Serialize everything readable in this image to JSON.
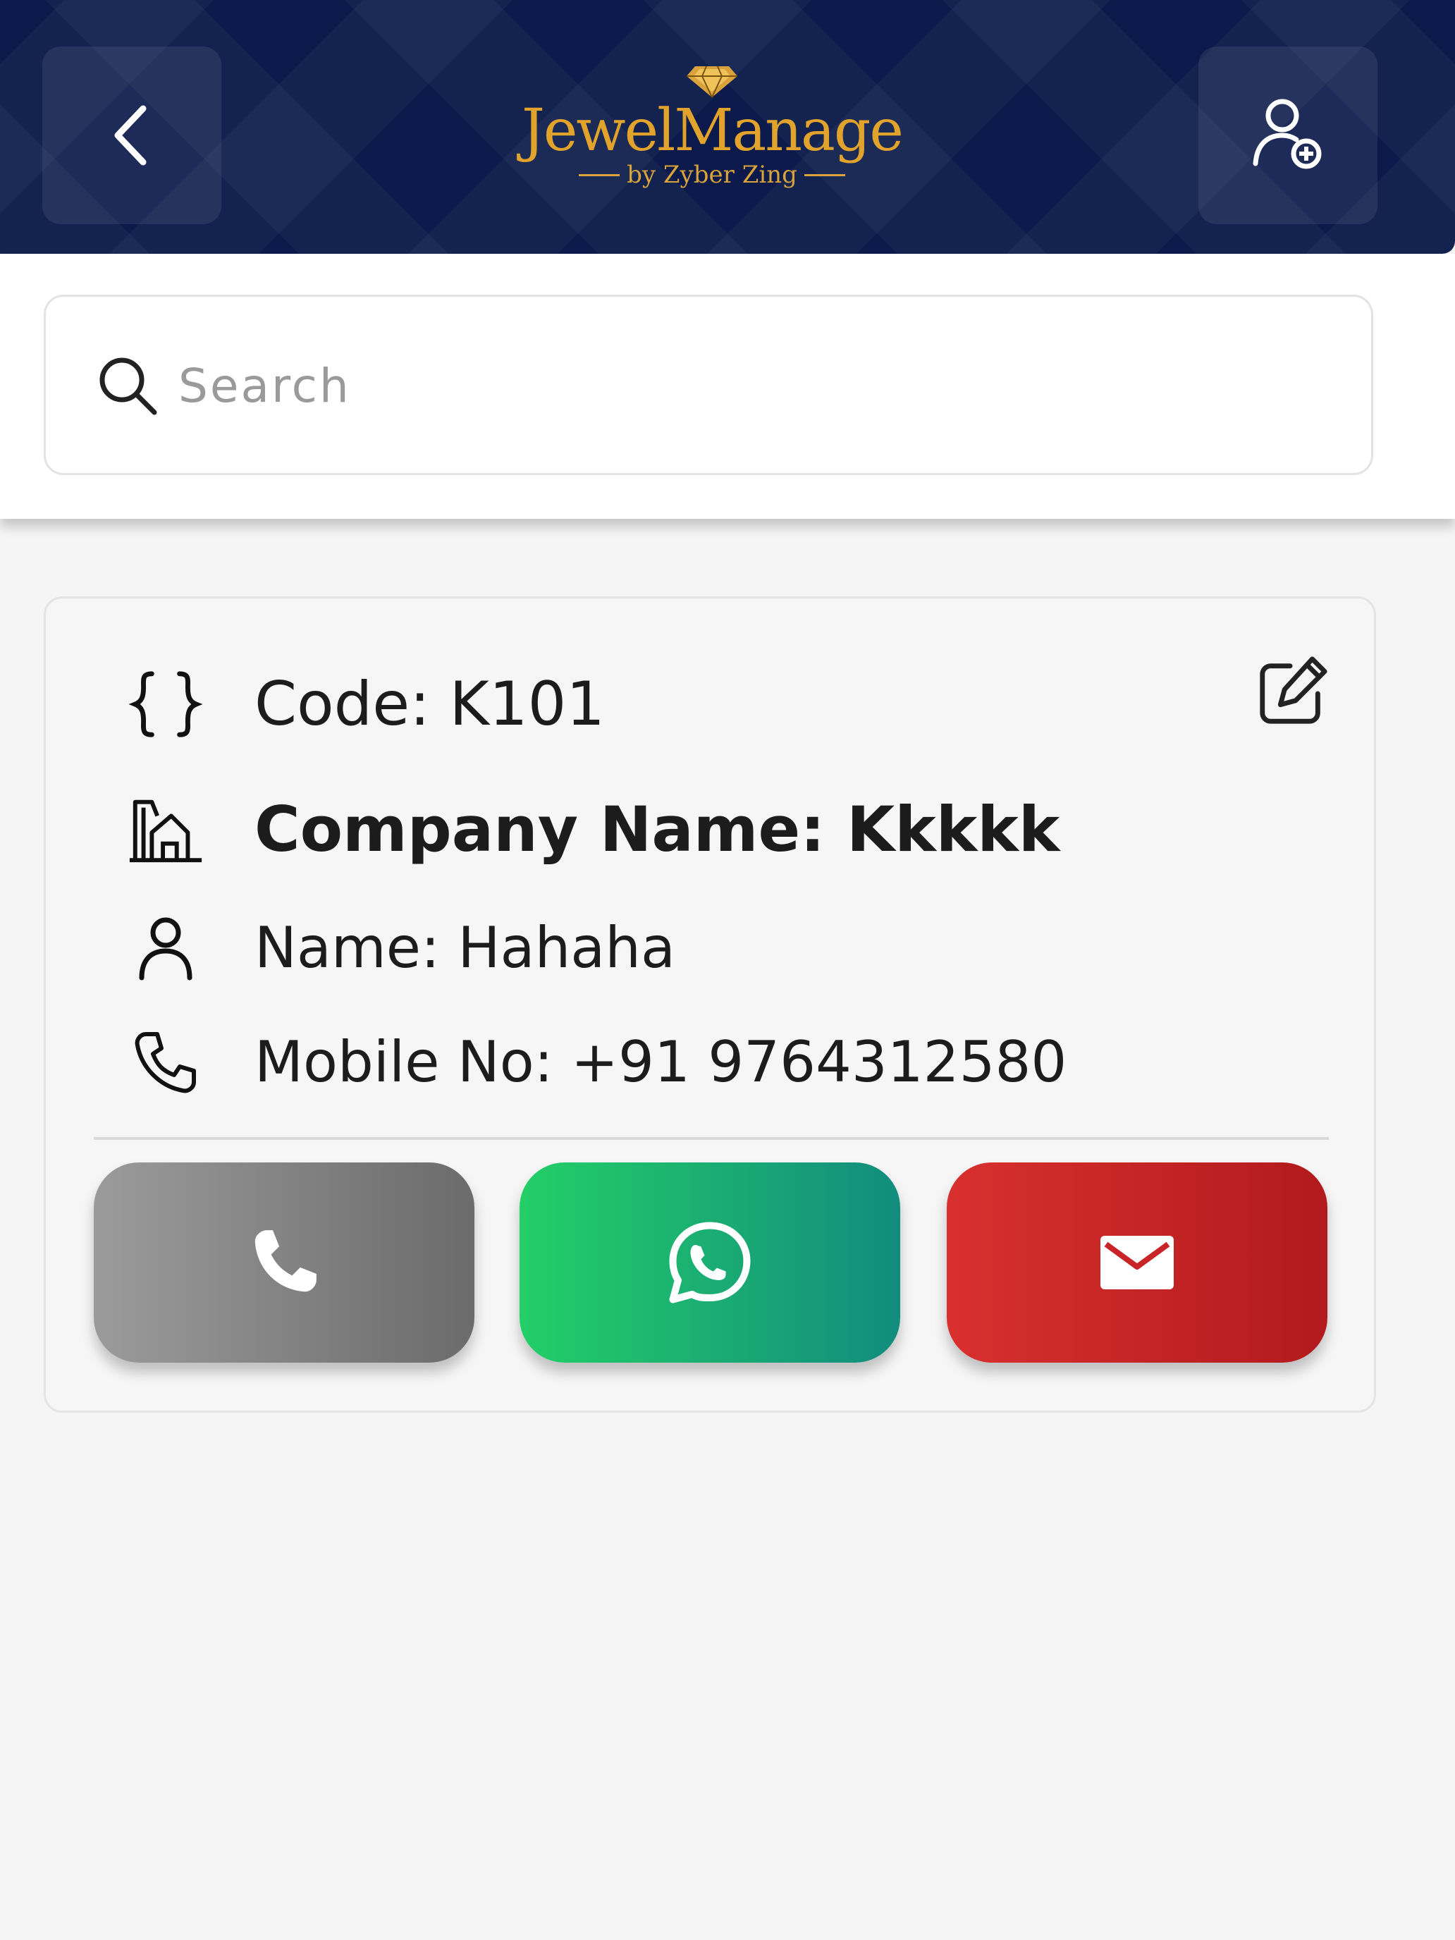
{
  "header": {
    "brand": "JewelManage",
    "byline": "by Zyber Zing",
    "back_icon": "chevron-left-icon",
    "add_user_icon": "user-plus-icon"
  },
  "search": {
    "placeholder": "Search",
    "value": ""
  },
  "card": {
    "code": "Code: K101",
    "company": "Company Name: Kkkkk",
    "name": "Name: Hahaha",
    "mobile": "Mobile No: +91 9764312580",
    "actions": [
      {
        "name": "call",
        "icon": "phone-icon",
        "color": "#7d7d7d"
      },
      {
        "name": "whatsapp",
        "icon": "whatsapp-icon",
        "color": "#1fb86c"
      },
      {
        "name": "email",
        "icon": "mail-icon",
        "color": "#c92427"
      }
    ]
  },
  "colors": {
    "header_bg": "#0b1a4a",
    "brand_gold": "#e2a32c"
  }
}
